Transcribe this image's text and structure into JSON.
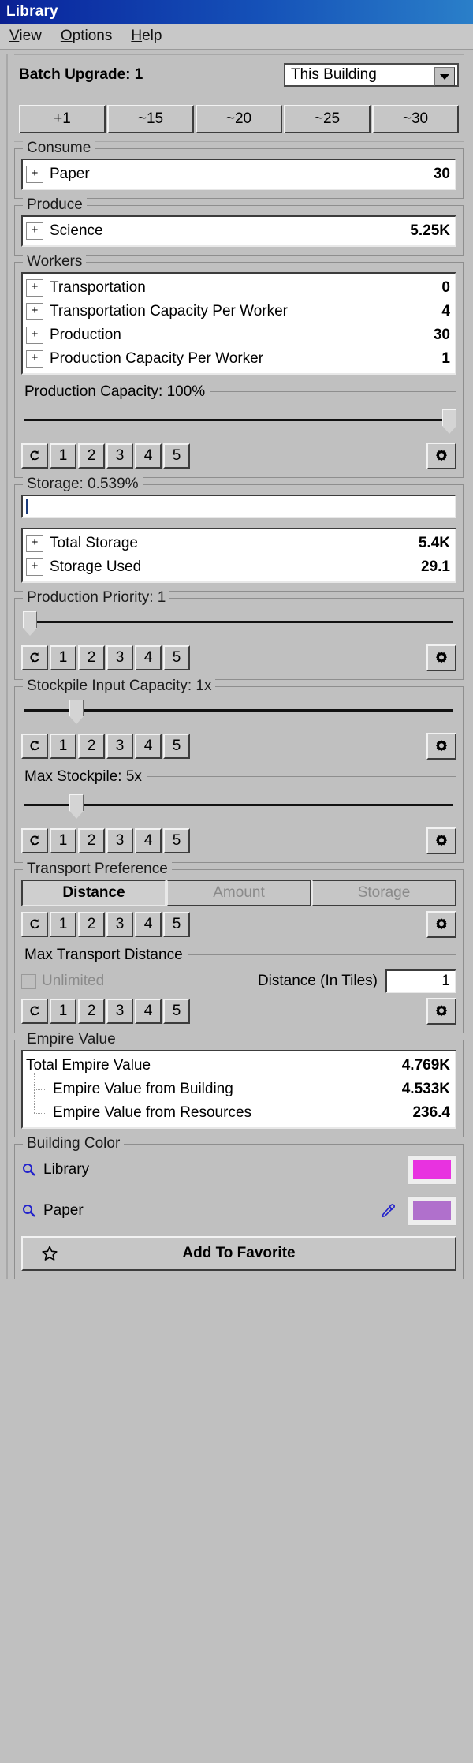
{
  "window": {
    "title": "Library"
  },
  "menubar": {
    "items": [
      {
        "accel": "V",
        "rest": "iew"
      },
      {
        "accel": "O",
        "rest": "ptions"
      },
      {
        "accel": "H",
        "rest": "elp"
      }
    ]
  },
  "batch": {
    "label": "Batch Upgrade: 1",
    "scope_selected": "This Building",
    "scope_options": [
      "This Building"
    ],
    "buttons": [
      "+1",
      "~15",
      "~20",
      "~25",
      "~30"
    ]
  },
  "consume": {
    "legend": "Consume",
    "rows": [
      {
        "expander": "+",
        "name": "Paper",
        "value": "30"
      }
    ]
  },
  "produce": {
    "legend": "Produce",
    "rows": [
      {
        "expander": "+",
        "name": "Science",
        "value": "5.25K"
      }
    ]
  },
  "workers": {
    "legend": "Workers",
    "rows": [
      {
        "expander": "+",
        "name": "Transportation",
        "value": "0"
      },
      {
        "expander": "+",
        "name": "Transportation Capacity Per Worker",
        "value": "4"
      },
      {
        "expander": "+",
        "name": "Production",
        "value": "30"
      },
      {
        "expander": "+",
        "name": "Production Capacity Per Worker",
        "value": "1"
      }
    ]
  },
  "production_capacity": {
    "legend": "Production Capacity: 100%",
    "slider_percent": 100,
    "preset_buttons": [
      "1",
      "2",
      "3",
      "4",
      "5"
    ],
    "reset_icon": "reset-icon",
    "gear_icon": "gear-icon"
  },
  "storage": {
    "legend": "Storage: 0.539%",
    "input_value": "",
    "rows": [
      {
        "expander": "+",
        "name": "Total Storage",
        "value": "5.4K"
      },
      {
        "expander": "+",
        "name": "Storage Used",
        "value": "29.1"
      }
    ]
  },
  "production_priority": {
    "legend": "Production Priority: 1",
    "slider_percent": 0,
    "preset_buttons": [
      "1",
      "2",
      "3",
      "4",
      "5"
    ]
  },
  "stockpile": {
    "input_capacity": {
      "legend": "Stockpile Input Capacity: 1x",
      "slider_percent": 11,
      "preset_buttons": [
        "1",
        "2",
        "3",
        "4",
        "5"
      ]
    },
    "max_stockpile": {
      "legend": "Max Stockpile: 5x",
      "slider_percent": 11,
      "preset_buttons": [
        "1",
        "2",
        "3",
        "4",
        "5"
      ]
    }
  },
  "transport": {
    "legend": "Transport Preference",
    "tabs": [
      {
        "label": "Distance",
        "active": true
      },
      {
        "label": "Amount",
        "active": false
      },
      {
        "label": "Storage",
        "active": false
      }
    ],
    "preset_buttons": [
      "1",
      "2",
      "3",
      "4",
      "5"
    ],
    "max_distance": {
      "legend": "Max Transport Distance",
      "unlimited_label": "Unlimited",
      "unlimited_checked": false,
      "distance_label": "Distance (In Tiles)",
      "distance_value": "1",
      "preset_buttons": [
        "1",
        "2",
        "3",
        "4",
        "5"
      ]
    }
  },
  "empire_value": {
    "legend": "Empire Value",
    "rows": [
      {
        "name": "Total Empire Value",
        "value": "4.769K",
        "indent": 0
      },
      {
        "name": "Empire Value from Building",
        "value": "4.533K",
        "indent": 1
      },
      {
        "name": "Empire Value from Resources",
        "value": "236.4",
        "indent": 1
      }
    ]
  },
  "building_color": {
    "legend": "Building Color",
    "rows": [
      {
        "name": "Library",
        "color": "#e832e0",
        "has_picker": false
      },
      {
        "name": "Paper",
        "color": "#b070cc",
        "has_picker": true
      }
    ],
    "favorite_button": "Add To Favorite"
  },
  "colors": {
    "title_start": "#0a1f8f",
    "title_end": "#2a7fc9",
    "panel_bg": "#c0c0c0",
    "link_blue": "#2222cc"
  }
}
